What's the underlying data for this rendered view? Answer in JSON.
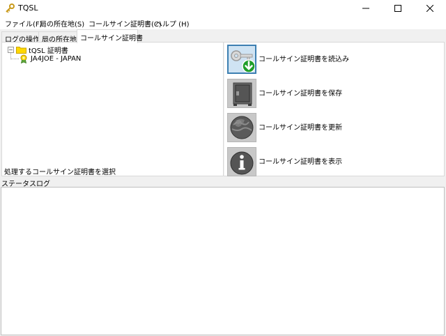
{
  "window": {
    "title": "TQSL",
    "app_icon": "key-icon"
  },
  "menubar": {
    "items": [
      "ファイル(F)",
      "局の所在地(S)",
      "コールサイン証明書(C)",
      "ヘルプ (H)"
    ]
  },
  "tabs": {
    "items": [
      "ログの操作",
      "局の所在地",
      "コールサイン証明書"
    ],
    "active_index": 2
  },
  "tree": {
    "root_label": "tQSL 証明書",
    "root_expander": "−",
    "child_label": "JA4JOE - JAPAN",
    "hint": "処理するコールサイン証明書を選択"
  },
  "actions": {
    "items": [
      {
        "label": "コールサイン証明書を読込み",
        "icon": "load-key-icon"
      },
      {
        "label": "コールサイン証明書を保存",
        "icon": "save-safe-icon"
      },
      {
        "label": "コールサイン証明書を更新",
        "icon": "renew-globe-icon"
      },
      {
        "label": "コールサイン証明書を表示",
        "icon": "info-icon"
      }
    ],
    "selected_index": 0
  },
  "status": {
    "header": "ステータスログ",
    "log_text": ""
  },
  "colors": {
    "selection_border": "#3c7fb1",
    "folder_yellow": "#ffd800",
    "green_arrow": "#1f9e2a"
  }
}
